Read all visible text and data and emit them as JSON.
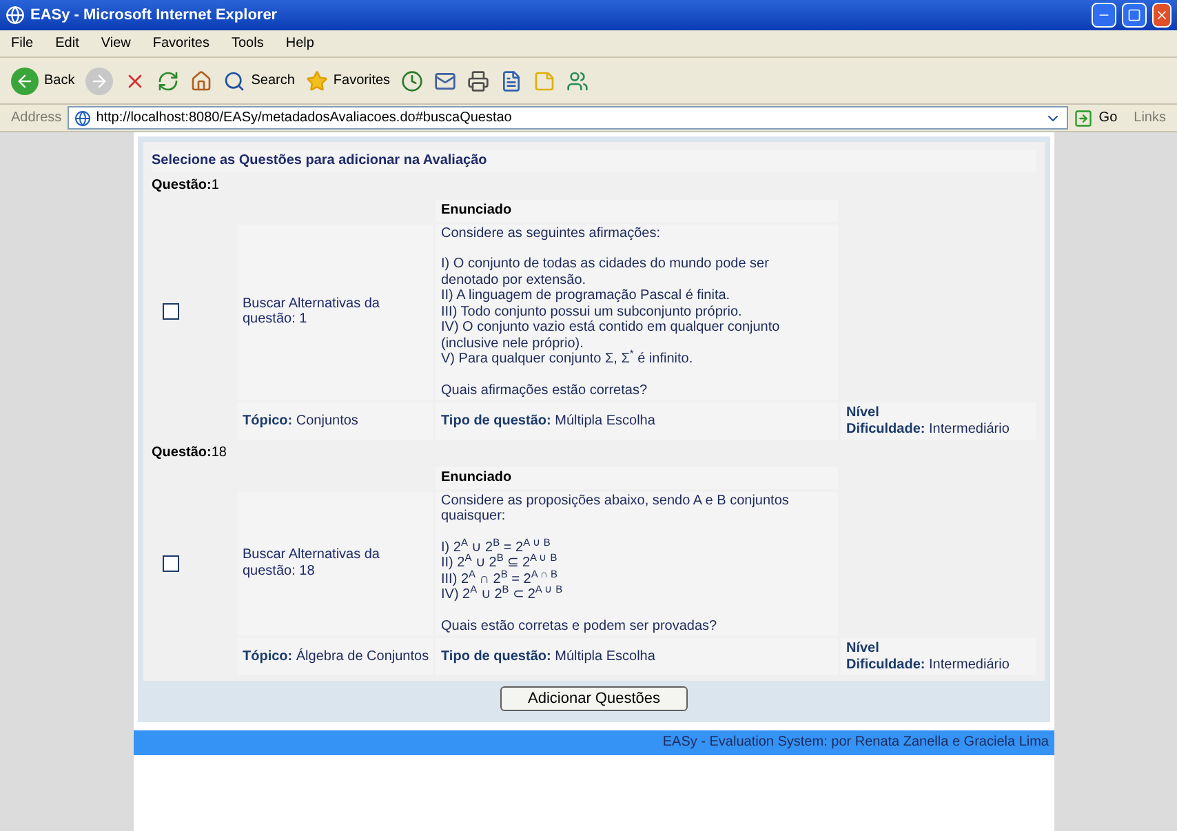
{
  "window": {
    "title": "EASy - Microsoft Internet Explorer"
  },
  "menu": [
    "File",
    "Edit",
    "View",
    "Favorites",
    "Tools",
    "Help"
  ],
  "toolbar": {
    "back": "Back",
    "search": "Search",
    "favorites": "Favorites"
  },
  "address": {
    "label": "Address",
    "url": "http://localhost:8080/EASy/metadadosAvaliacoes.do#buscaQuestao",
    "go": "Go",
    "links": "Links"
  },
  "page": {
    "heading": "Selecione as Questões para adicionar na Avaliação",
    "questions": [
      {
        "label": "Questão:",
        "number": "1",
        "checked": false,
        "link": "Buscar Alternativas da questão: 1",
        "statement_header": "Enunciado",
        "intro": "Considere as seguintes afirmações:",
        "items": [
          "I) O conjunto de todas as cidades do mundo pode ser denotado por extensão.",
          "II) A linguagem de programação Pascal é finita.",
          "III) Todo conjunto possui um subconjunto próprio.",
          "IV) O conjunto vazio está contido em qualquer conjunto (inclusive nele próprio).",
          "V) Para qualquer conjunto Σ, Σ$^{*}$ é infinito."
        ],
        "question": "Quais afirmações estão corretas?",
        "topic_label": "Tópico:",
        "topic": "Conjuntos",
        "type_label": "Tipo de questão:",
        "type": "Múltipla Escolha",
        "level_label": "Nível",
        "difficulty_label": "Dificuldade:",
        "difficulty": "Intermediário"
      },
      {
        "label": "Questão:",
        "number": "18",
        "checked": false,
        "link": "Buscar Alternativas da questão: 18",
        "statement_header": "Enunciado",
        "intro": "Considere as proposições abaixo, sendo A e B conjuntos quaisquer:",
        "items": [
          "I) 2$^{A}$ ∪ 2$^{B}$ = 2$^{A ∪ B}$",
          "II) 2$^{A}$ ∪ 2$^{B}$ ⊆ 2$^{A ∪ B}$",
          "III) 2$^{A}$ ∩ 2$^{B}$ = 2$^{A ∩ B}$",
          "IV) 2$^{A}$ ∪ 2$^{B}$ ⊂ 2$^{A ∪ B}$"
        ],
        "question": "Quais estão corretas e podem ser provadas?",
        "topic_label": "Tópico:",
        "topic": "Álgebra de Conjuntos",
        "type_label": "Tipo de questão:",
        "type": "Múltipla Escolha",
        "level_label": "Nível",
        "difficulty_label": "Dificuldade:",
        "difficulty": "Intermediário"
      }
    ],
    "submit": "Adicionar Questões",
    "footer": "EASy - Evaluation System: por Renata Zanella e Graciela Lima"
  }
}
